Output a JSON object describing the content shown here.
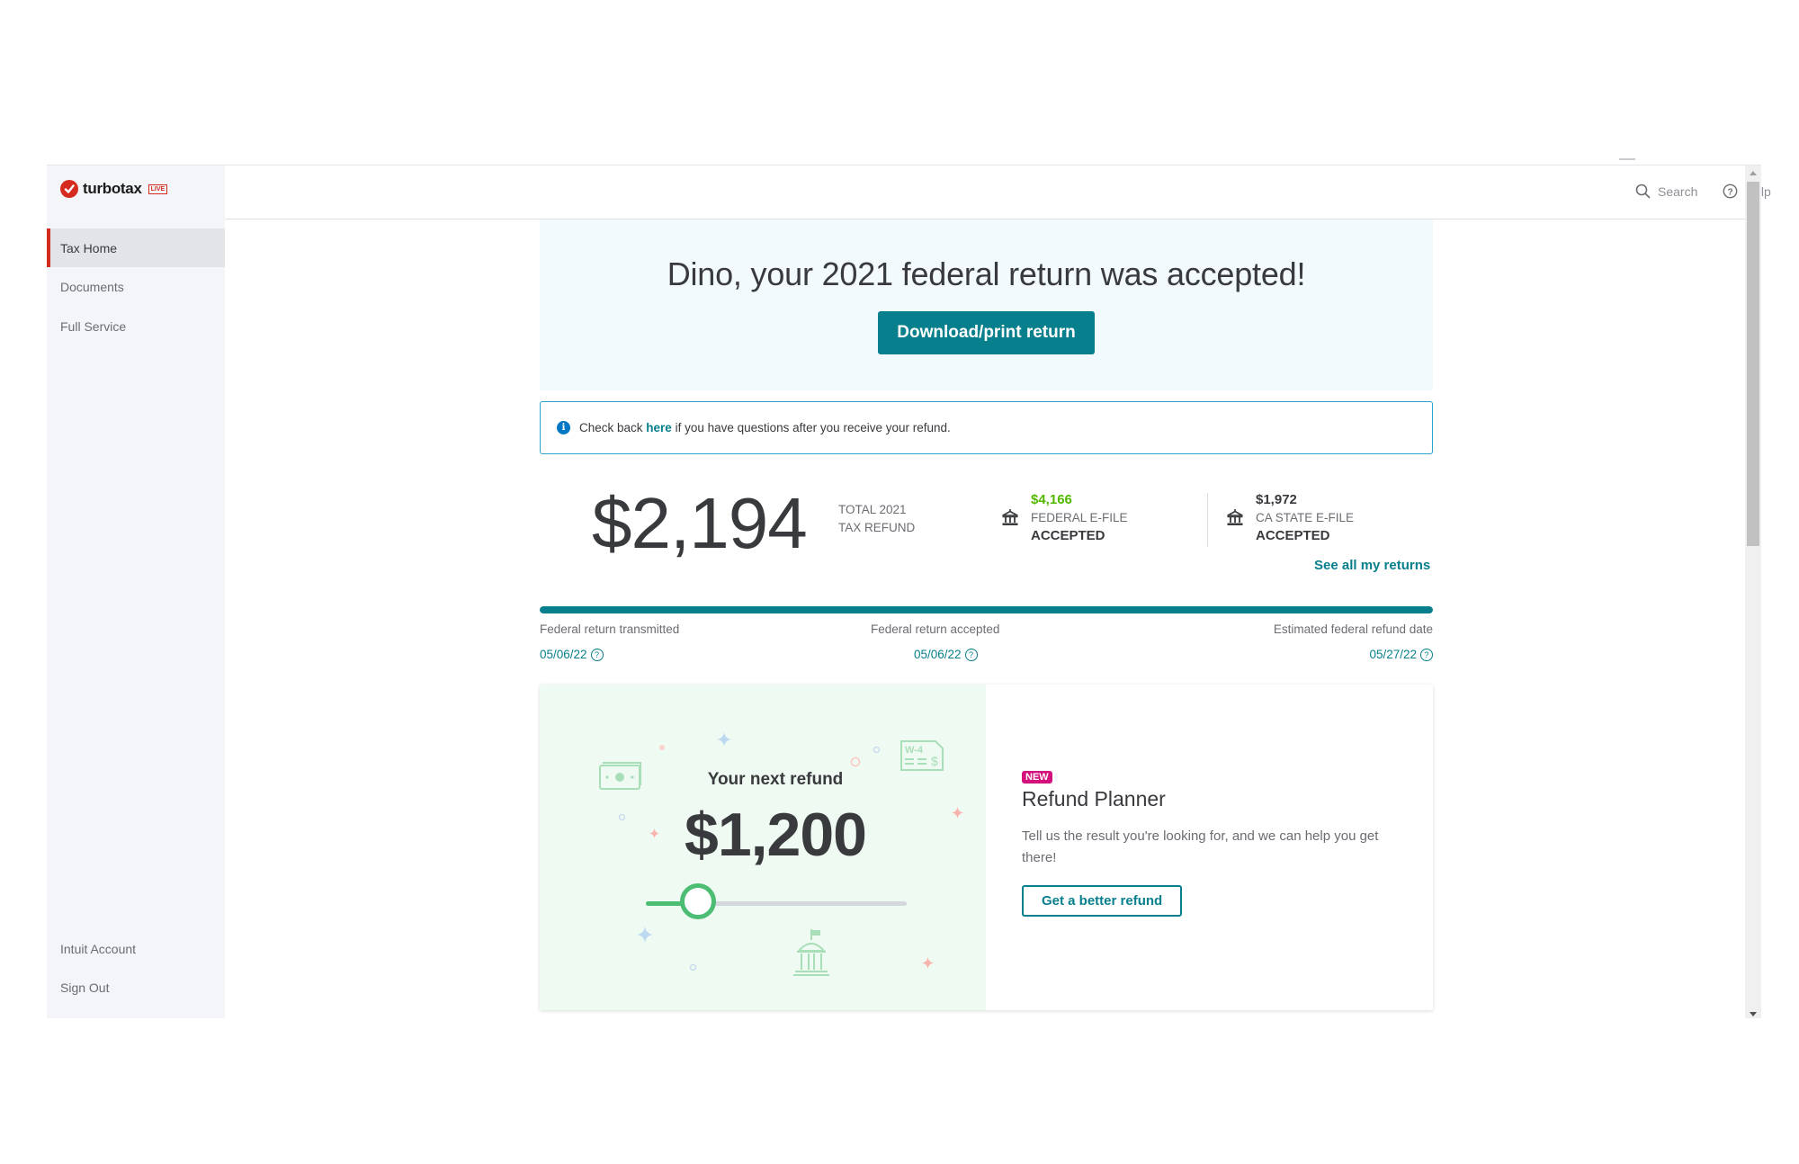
{
  "app": {
    "brand": "turbotax",
    "brand_badge": "LIVE",
    "accent_color": "#d52b1e",
    "primary_color": "#087f8c"
  },
  "sidebar": {
    "items": [
      {
        "label": "Tax Home",
        "active": true
      },
      {
        "label": "Documents",
        "active": false
      },
      {
        "label": "Full Service",
        "active": false
      }
    ],
    "bottom_items": [
      {
        "label": "Intuit Account"
      },
      {
        "label": "Sign Out"
      }
    ]
  },
  "topbar": {
    "search_label": "Search",
    "search_icon": "search-icon",
    "help_label": "Help",
    "help_icon": "question-circle-icon"
  },
  "hero": {
    "title": "Dino, your 2021 federal return was accepted!",
    "button_label": "Download/print return"
  },
  "info": {
    "icon": "info-icon",
    "prefix": "Check back ",
    "link_text": "here",
    "suffix": " if you have questions after you receive your refund."
  },
  "refund": {
    "total": "$2,194",
    "caption_line1": "TOTAL 2021",
    "caption_line2": "TAX REFUND",
    "federal": {
      "amount": "$4,166",
      "label": "FEDERAL E-FILE",
      "status": "ACCEPTED",
      "amount_color": "#53b700"
    },
    "state": {
      "amount": "$1,972",
      "label": "CA STATE E-FILE",
      "status": "ACCEPTED",
      "amount_color": "#393a3d"
    },
    "see_all_link": "See all my returns"
  },
  "progress": {
    "percent": 100,
    "milestones": [
      {
        "label": "Federal return transmitted",
        "date": "05/06/22"
      },
      {
        "label": "Federal return accepted",
        "date": "05/06/22"
      },
      {
        "label": "Estimated federal refund date",
        "date": "05/27/22"
      }
    ]
  },
  "planner": {
    "next_label": "Your next refund",
    "next_amount": "$1,200",
    "slider_fraction": 0.2,
    "badge": "NEW",
    "title": "Refund Planner",
    "description": "Tell us the result you're looking for, and we can help you get there!",
    "button_label": "Get a better refund",
    "slider_color": "#4dbd74",
    "badge_color": "#d4107c"
  }
}
